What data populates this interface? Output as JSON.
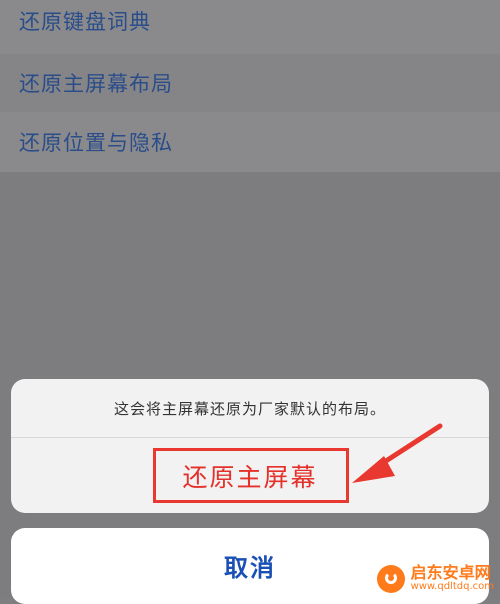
{
  "list": {
    "items": [
      {
        "label": "还原键盘词典"
      },
      {
        "label": "还原主屏幕布局"
      },
      {
        "label": "还原位置与隐私"
      }
    ]
  },
  "action_sheet": {
    "message": "这会将主屏幕还原为厂家默认的布局。",
    "action_label": "还原主屏幕",
    "cancel_label": "取消"
  },
  "colors": {
    "accent_blue": "#1a4fb5",
    "destructive_red": "#e4322b",
    "highlight_box": "#e8382f"
  },
  "watermark": {
    "title": "启东安卓网",
    "url": "www.qdltdq.com"
  }
}
